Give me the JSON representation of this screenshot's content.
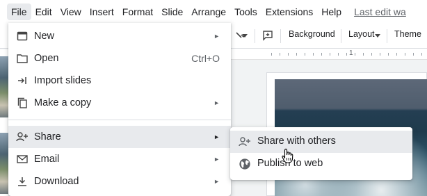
{
  "menubar": {
    "items": [
      "File",
      "Edit",
      "View",
      "Insert",
      "Format",
      "Slide",
      "Arrange",
      "Tools",
      "Extensions",
      "Help"
    ],
    "last_edit": "Last edit wa"
  },
  "toolbar": {
    "background_label": "Background",
    "layout_label": "Layout",
    "theme_label": "Theme"
  },
  "ruler": {
    "mark": "1"
  },
  "file_menu": {
    "items": [
      {
        "label": "New",
        "icon": "slides-icon",
        "submenu": true
      },
      {
        "label": "Open",
        "icon": "folder-icon",
        "shortcut": "Ctrl+O"
      },
      {
        "label": "Import slides",
        "icon": "import-icon"
      },
      {
        "label": "Make a copy",
        "icon": "copy-icon",
        "submenu": true
      },
      {
        "label": "Share",
        "icon": "person-add-icon",
        "submenu": true,
        "highlighted": true
      },
      {
        "label": "Email",
        "icon": "mail-icon",
        "submenu": true
      },
      {
        "label": "Download",
        "icon": "download-icon",
        "submenu": true
      }
    ]
  },
  "share_submenu": {
    "items": [
      {
        "label": "Share with others",
        "icon": "person-add-icon",
        "highlighted": true
      },
      {
        "label": "Publish to web",
        "icon": "globe-icon"
      }
    ]
  },
  "colors": {
    "hover": "#e8eaed",
    "text": "#202124",
    "muted": "#5f6368"
  }
}
